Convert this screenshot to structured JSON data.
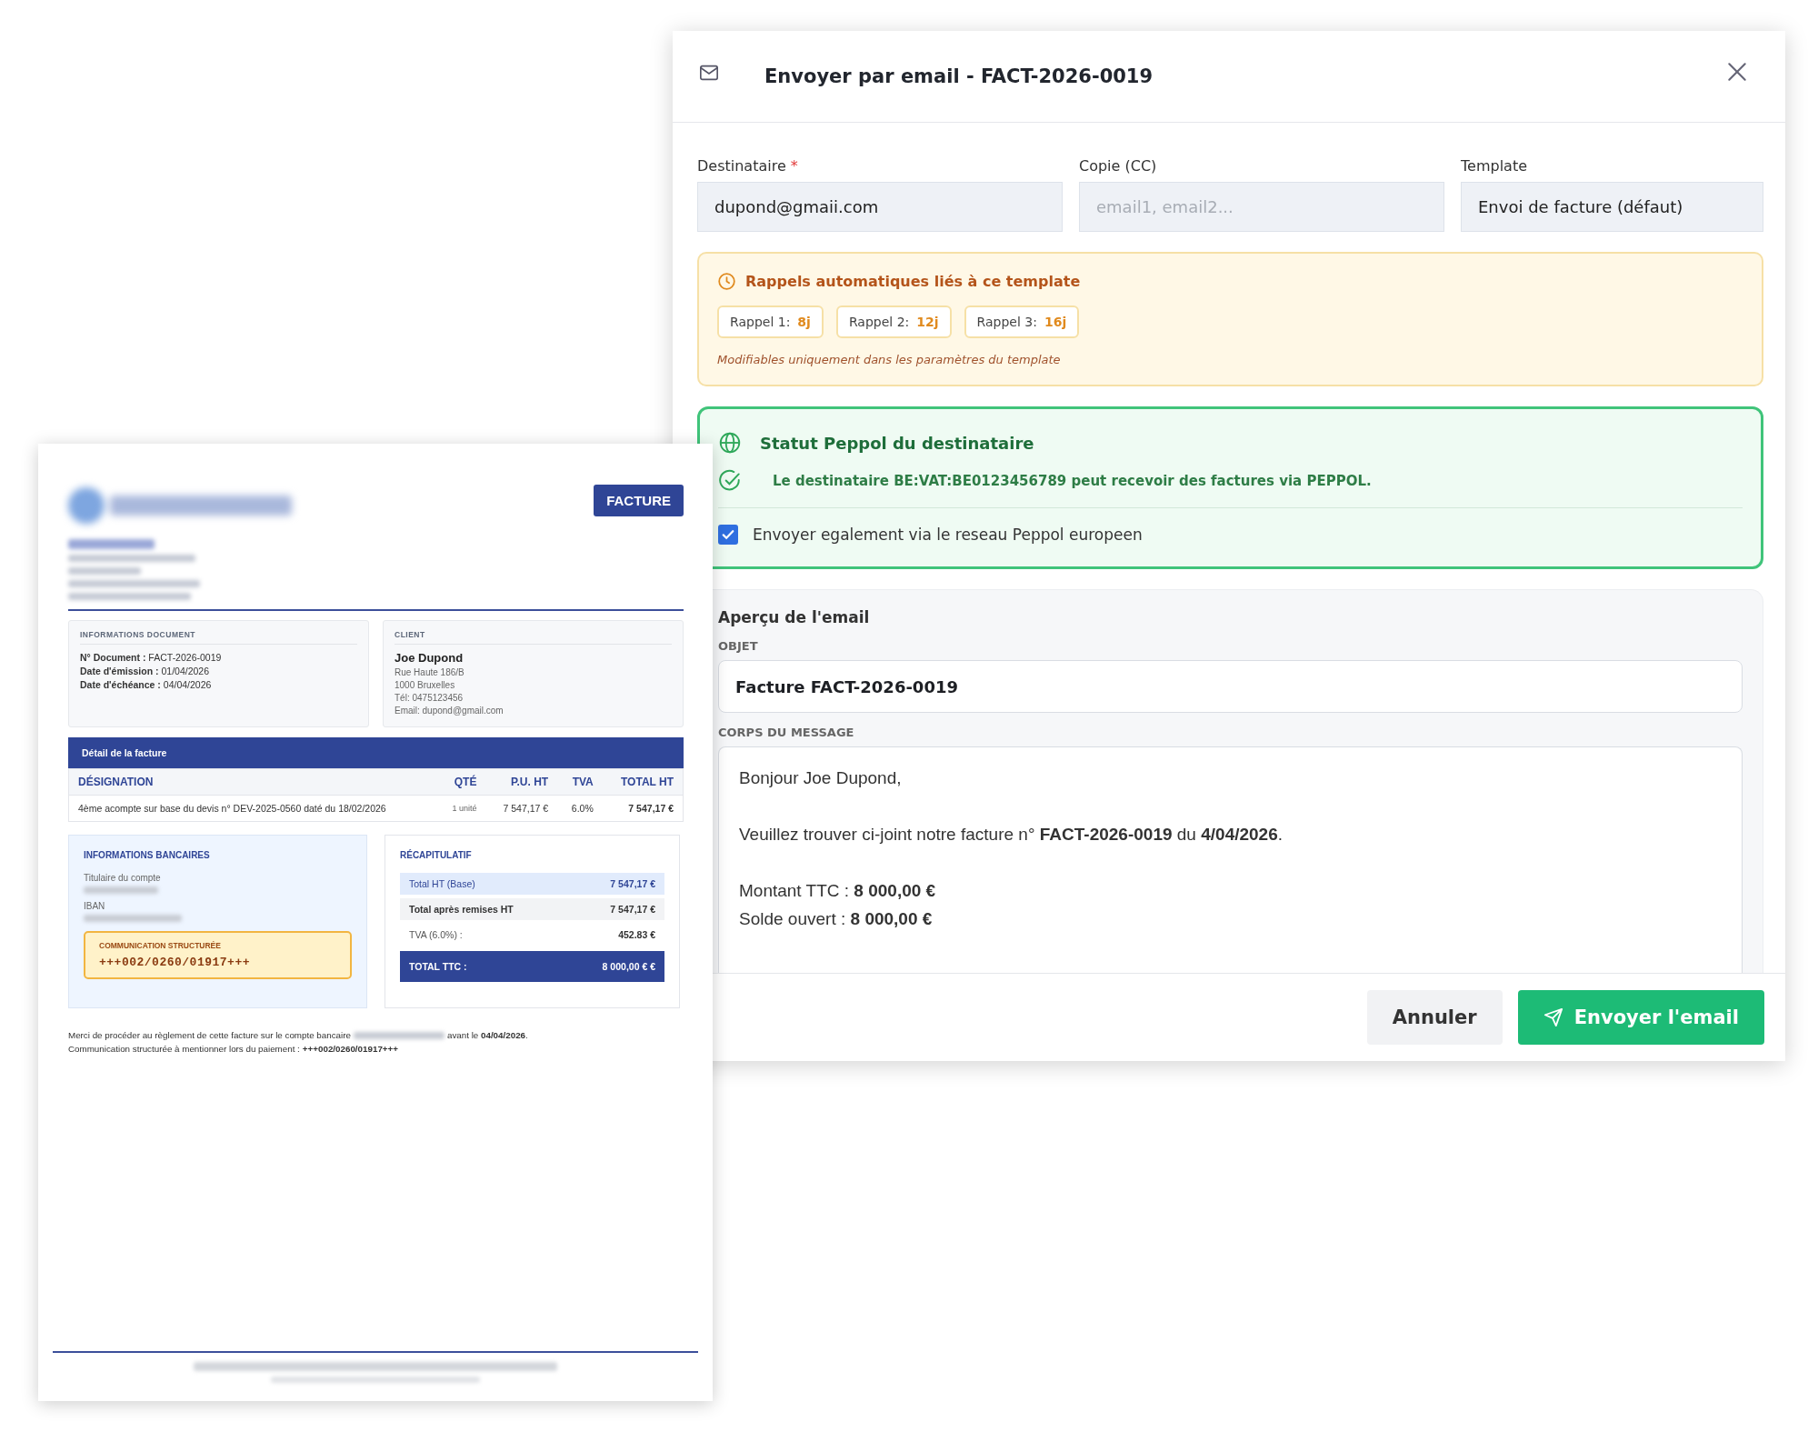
{
  "invoice": {
    "badge": "FACTURE",
    "doc_info": {
      "title": "INFORMATIONS DOCUMENT",
      "lines": [
        {
          "label": "N° Document :",
          "value": "FACT-2026-0019"
        },
        {
          "label": "Date d'émission :",
          "value": "01/04/2026"
        },
        {
          "label": "Date d'échéance :",
          "value": "04/04/2026"
        }
      ]
    },
    "client": {
      "title": "CLIENT",
      "name": "Joe Dupond",
      "lines": [
        "Rue Haute 186/B",
        "1000 Bruxelles",
        "Tél: 0475123456",
        "Email: dupond@gmail.com"
      ]
    },
    "detail": {
      "title": "Détail de la facture",
      "columns": [
        "DÉSIGNATION",
        "QTÉ",
        "P.U. HT",
        "TVA",
        "TOTAL HT"
      ],
      "rows": [
        [
          "4ème acompte sur base du devis n° DEV-2025-0560 daté du 18/02/2026",
          "1 unité",
          "7 547,17 €",
          "6.0%",
          "7 547,17 €"
        ]
      ]
    },
    "bank": {
      "title": "INFORMATIONS BANCAIRES",
      "holder_label": "Titulaire du compte",
      "iban_label": "IBAN",
      "communication": {
        "label": "COMMUNICATION STRUCTURÉE",
        "value": "+++002/0260/01917+++"
      }
    },
    "summary": {
      "title": "RÉCAPITULATIF",
      "rows": [
        {
          "kind": "base",
          "label": "Total HT (Base)",
          "value": "7 547,17 €"
        },
        {
          "kind": "subtotal",
          "label": "Total après remises HT",
          "value": "7 547,17 €"
        },
        {
          "kind": "plain",
          "label": "TVA (6.0%) :",
          "value": "452.83 €"
        },
        {
          "kind": "total",
          "label": "TOTAL TTC :",
          "value": "8 000,00 € €"
        }
      ]
    },
    "notes": {
      "before": "Merci de procéder au règlement de cette facture sur le compte bancaire",
      "after": "avant le **04/04/2026**.",
      "second": "Communication structurée à mentionner lors du paiement : **+++002/0260/01917+++**"
    }
  },
  "email_dialog": {
    "title": "Envoyer par email - FACT-2026-0019",
    "fields": [
      {
        "label": "Destinataire",
        "required_mark": "*",
        "value": "dupond@gmaii.com"
      },
      {
        "label": "Copie (CC)",
        "placeholder": "email1, email2..."
      },
      {
        "label": "Template",
        "value": "Envoi de facture (défaut)"
      }
    ],
    "reminders": {
      "title": "Rappels automatiques liés à ce template",
      "items": [
        {
          "label": "Rappel 1:",
          "days": "8j"
        },
        {
          "label": "Rappel 2:",
          "days": "12j"
        },
        {
          "label": "Rappel 3:",
          "days": "16j"
        }
      ],
      "note": "Modifiables uniquement dans les paramètres du template"
    },
    "peppol": {
      "title": "Statut Peppol du destinataire",
      "message": "Le destinataire BE:VAT:BE0123456789 peut recevoir des factures via PEPPOL.",
      "checkbox": {
        "label": "Envoyer egalement via le reseau Peppol europeen",
        "checked": true
      }
    },
    "preview": {
      "title": "Aperçu de l'email",
      "subject_label": "OBJET",
      "subject": "Facture FACT-2026-0019",
      "body_label": "CORPS DU MESSAGE",
      "paragraphs": [
        [
          "Bonjour Joe Dupond,"
        ],
        [
          "Veuillez trouver ci-joint notre facture n° **FACT-2026-0019** du **4/04/2026**."
        ],
        [
          "Montant TTC : **8 000,00 €**",
          "Solde ouvert : **8 000,00 €**"
        ]
      ]
    },
    "buttons": [
      {
        "label": "Annuler",
        "kind": "secondary"
      },
      {
        "label": "Envoyer l'email",
        "kind": "primary"
      }
    ]
  }
}
